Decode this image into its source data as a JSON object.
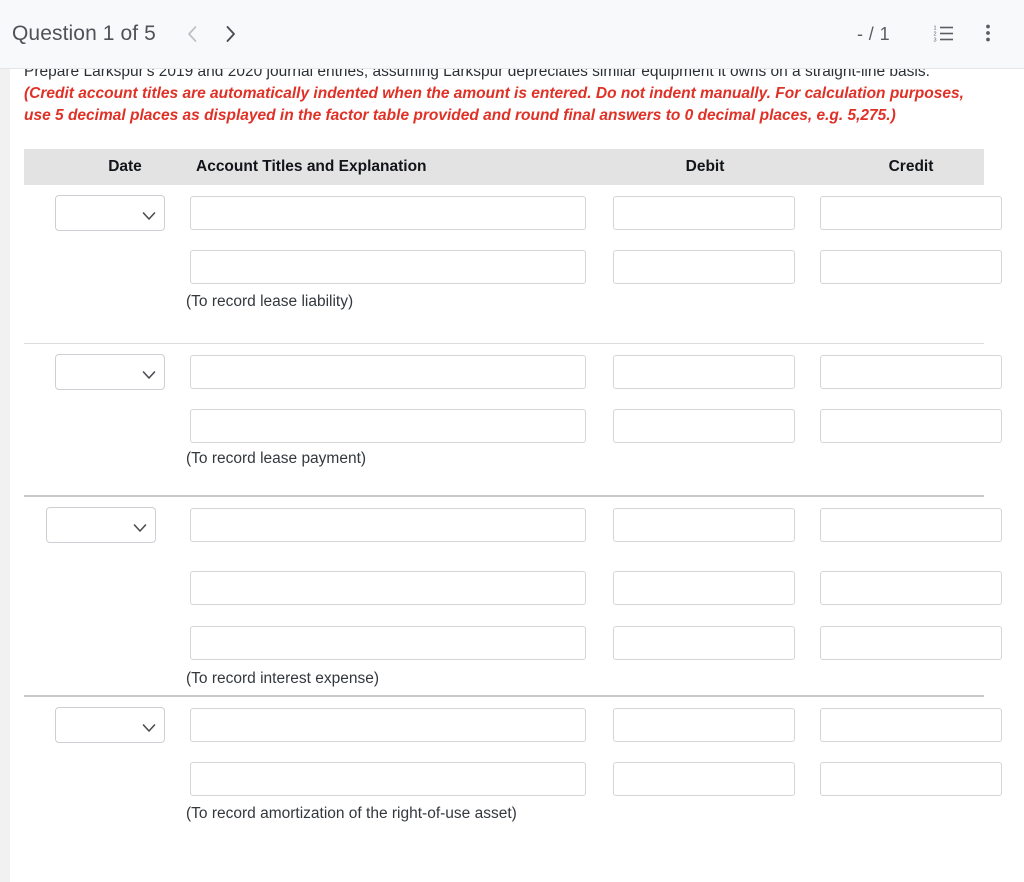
{
  "toolbar": {
    "question_counter": "Question 1 of 5",
    "prev_label": "Previous question",
    "next_label": "Next question",
    "score_display": "- / 1",
    "list_icon": "numbered-list-icon",
    "menu_icon": "kebab-menu-icon"
  },
  "content": {
    "intro_text": "Prepare Larkspur's 2019 and 2020 journal entries, assuming Larkspur depreciates similar equipment it owns on a straight-line basis.",
    "instruction_text": "(Credit account titles are automatically indented when the amount is entered. Do not indent manually. For calculation purposes, use 5 decimal places as displayed in the factor table provided and round final answers to 0 decimal places, e.g. 5,275.)"
  },
  "table": {
    "headers": {
      "date": "Date",
      "account": "Account Titles and Explanation",
      "debit": "Debit",
      "credit": "Credit"
    },
    "date_select_value": "",
    "date_select_options": [
      ""
    ],
    "account_placeholder": "",
    "debit_placeholder": "",
    "credit_placeholder": "",
    "entries": [
      {
        "memo": "(To record lease liability)",
        "lines": [
          {
            "date": "",
            "account": "",
            "debit": "",
            "credit": ""
          },
          {
            "date": "",
            "account": "",
            "debit": "",
            "credit": ""
          }
        ]
      },
      {
        "memo": "(To record lease payment)",
        "lines": [
          {
            "date": "",
            "account": "",
            "debit": "",
            "credit": ""
          },
          {
            "date": "",
            "account": "",
            "debit": "",
            "credit": ""
          }
        ]
      },
      {
        "memo": "(To record interest expense)",
        "lines": [
          {
            "date": "",
            "account": "",
            "debit": "",
            "credit": ""
          },
          {
            "date": "",
            "account": "",
            "debit": "",
            "credit": ""
          },
          {
            "date": "",
            "account": "",
            "debit": "",
            "credit": ""
          }
        ]
      },
      {
        "memo": "(To record amortization of the right-of-use asset)",
        "lines": [
          {
            "date": "",
            "account": "",
            "debit": "",
            "credit": ""
          },
          {
            "date": "",
            "account": "",
            "debit": "",
            "credit": ""
          }
        ]
      }
    ]
  },
  "colors": {
    "instruction_red": "#e03127",
    "header_band": "#e3e3e3",
    "toolbar_bg": "#f8f9fa",
    "page_bg": "#f1f1f1"
  }
}
